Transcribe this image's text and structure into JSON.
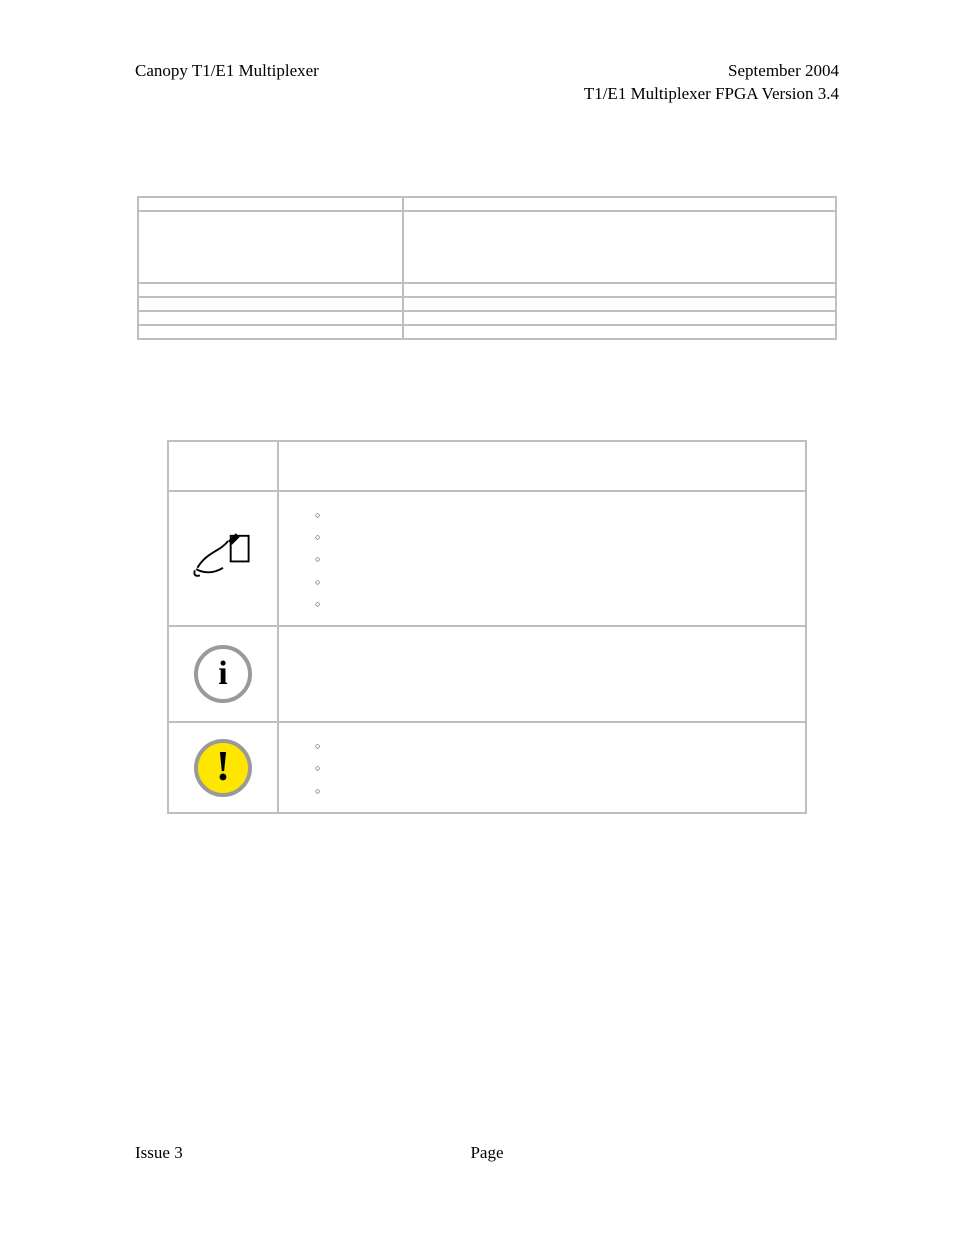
{
  "header": {
    "left": "Canopy T1/E1 Multiplexer",
    "right_line1": "September 2004",
    "right_line2": "T1/E1 Multiplexer FPGA Version 3.4"
  },
  "table1": {
    "rows": [
      {
        "c1": "",
        "c2": "",
        "tall": false
      },
      {
        "c1": "",
        "c2": "",
        "tall": true
      },
      {
        "c1": "",
        "c2": "",
        "tall": false
      },
      {
        "c1": "",
        "c2": "",
        "tall": false
      },
      {
        "c1": "",
        "c2": "",
        "tall": false
      },
      {
        "c1": "",
        "c2": "",
        "tall": false
      }
    ]
  },
  "table2": {
    "header": {
      "c1": "",
      "c2": ""
    },
    "rows": [
      {
        "icon": "note",
        "intro": "",
        "bullets": [
          "",
          "",
          "",
          "",
          ""
        ]
      },
      {
        "icon": "info",
        "intro": "",
        "bullets": []
      },
      {
        "icon": "warn",
        "intro": "",
        "bullets": [
          "",
          "",
          ""
        ]
      }
    ]
  },
  "footer": {
    "left": "Issue 3",
    "mid": "Page",
    "right": ""
  },
  "icons": {
    "note": "note-icon",
    "info": "info-icon",
    "warn": "warn-icon"
  }
}
